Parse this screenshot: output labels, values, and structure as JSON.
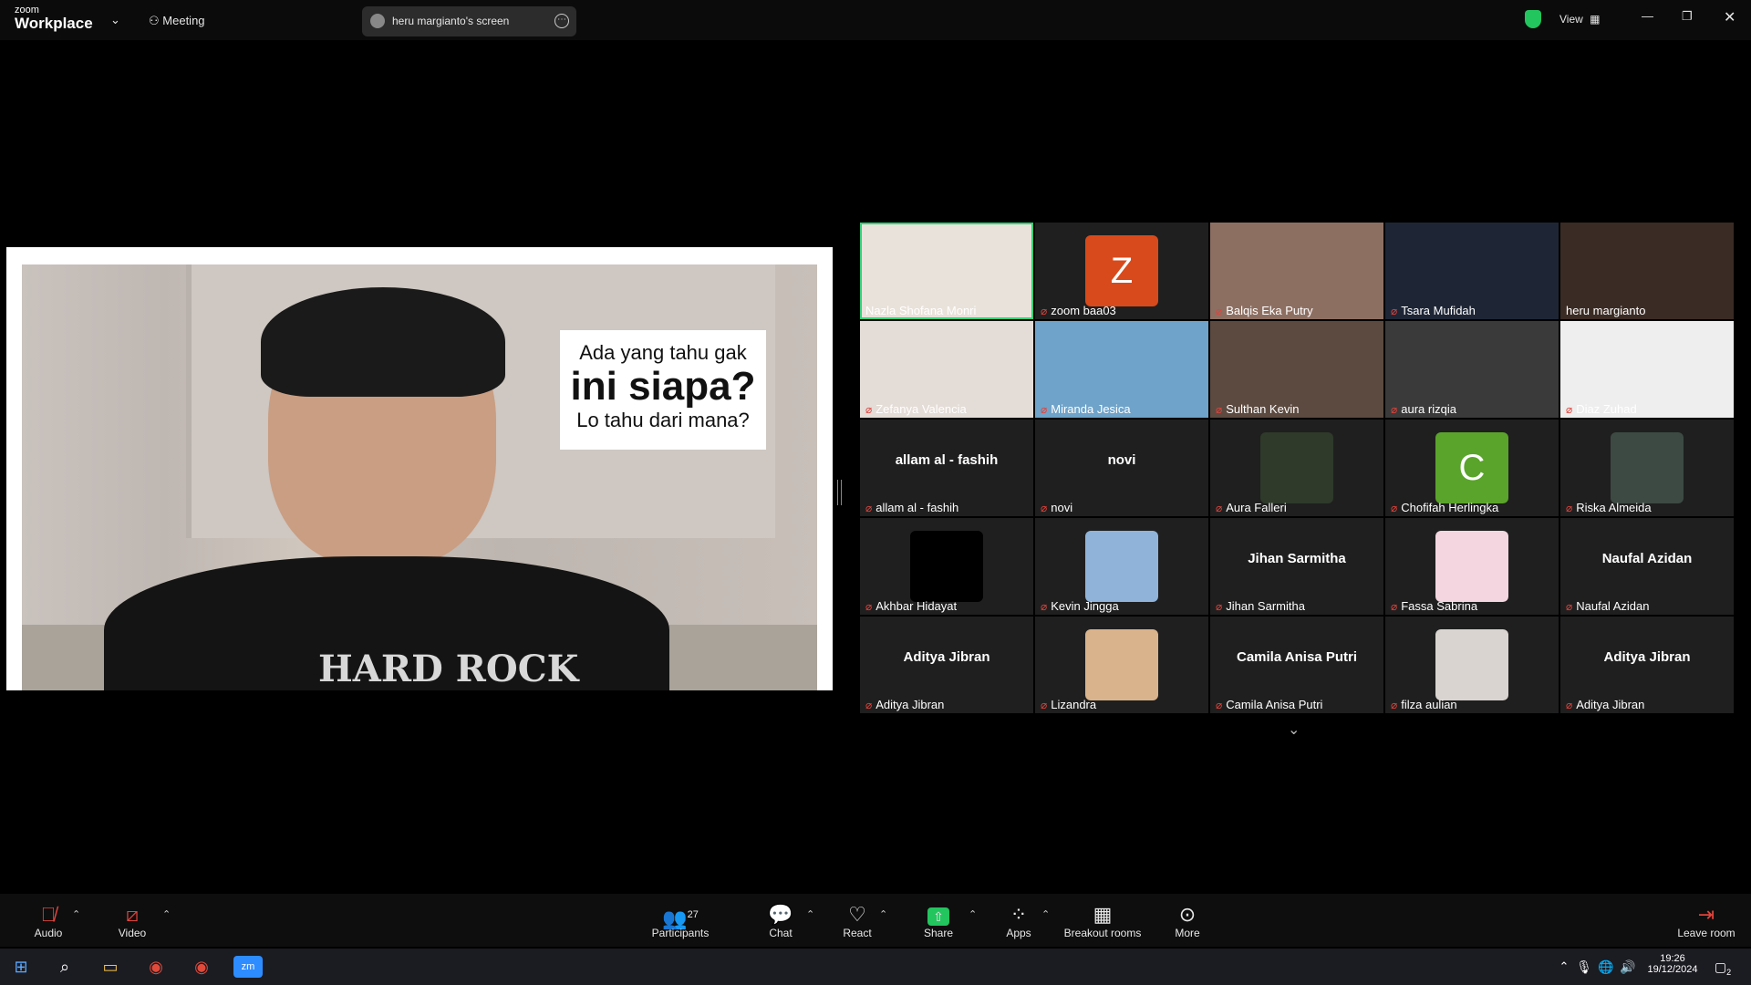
{
  "app": {
    "logo_small": "zoom",
    "logo_big": "Workplace",
    "meeting_label": "Meeting",
    "view_label": "View"
  },
  "share_pill": {
    "label": "heru margianto's screen"
  },
  "shared_screen": {
    "overlay_line1": "Ada yang tahu gak",
    "overlay_line2": "ini siapa?",
    "overlay_line3": "Lo tahu dari mana?",
    "shirt_text": "HARD ROCK"
  },
  "participants_grid": [
    {
      "name": "Nazla Shofana Monri",
      "muted": false,
      "active": true
    },
    {
      "name": "zoom baa03",
      "muted": true,
      "avatar_letter": "Z",
      "avatar_color": "#d84a1b"
    },
    {
      "name": "Balqis Eka Putry",
      "muted": true
    },
    {
      "name": "Tsara Mufidah",
      "muted": true
    },
    {
      "name": "heru margianto",
      "muted": false
    },
    {
      "name": "Zefanya Valencia",
      "muted": true
    },
    {
      "name": "Miranda Jesica",
      "muted": true
    },
    {
      "name": "Sulthan Kevin",
      "muted": true
    },
    {
      "name": "aura rizqia",
      "muted": true
    },
    {
      "name": "Diaz Zuhad",
      "muted": true
    },
    {
      "name": "allam al - fashih",
      "muted": true,
      "center_name": "allam al - fashih"
    },
    {
      "name": "novi",
      "muted": true,
      "center_name": "novi"
    },
    {
      "name": "Aura Falleri",
      "muted": true
    },
    {
      "name": "Chofifah Herlingka",
      "muted": true,
      "avatar_letter": "C",
      "avatar_color": "#5aa42b"
    },
    {
      "name": "Riska Almeida",
      "muted": true
    },
    {
      "name": "Akhbar Hidayat",
      "muted": true
    },
    {
      "name": "Kevin Jingga",
      "muted": true
    },
    {
      "name": "Jihan Sarmitha",
      "muted": true,
      "center_name": "Jihan Sarmitha"
    },
    {
      "name": "Fassa Sabrina",
      "muted": true
    },
    {
      "name": "Naufal Azidan",
      "muted": true,
      "center_name": "Naufal Azidan"
    },
    {
      "name": "Aditya Jibran",
      "muted": true,
      "center_name": "Aditya Jibran"
    },
    {
      "name": "Lizandra",
      "muted": true
    },
    {
      "name": "Camila Anisa Putri",
      "muted": true,
      "center_name": "Camila Anisa Putri"
    },
    {
      "name": "filza aulian",
      "muted": true
    },
    {
      "name": "Aditya Jibran",
      "muted": true,
      "center_name": "Aditya Jibran"
    }
  ],
  "toolbar": {
    "audio": "Audio",
    "video": "Video",
    "participants": "Participants",
    "participants_count": "27",
    "chat": "Chat",
    "react": "React",
    "share": "Share",
    "apps": "Apps",
    "breakout": "Breakout rooms",
    "more": "More",
    "leave": "Leave room"
  },
  "taskbar": {
    "time": "19:26",
    "date": "19/12/2024",
    "notifications": "2"
  },
  "colors": {
    "active_speaker": "#33d17a",
    "share_green": "#22c55e",
    "muted_red": "#e0433c"
  }
}
